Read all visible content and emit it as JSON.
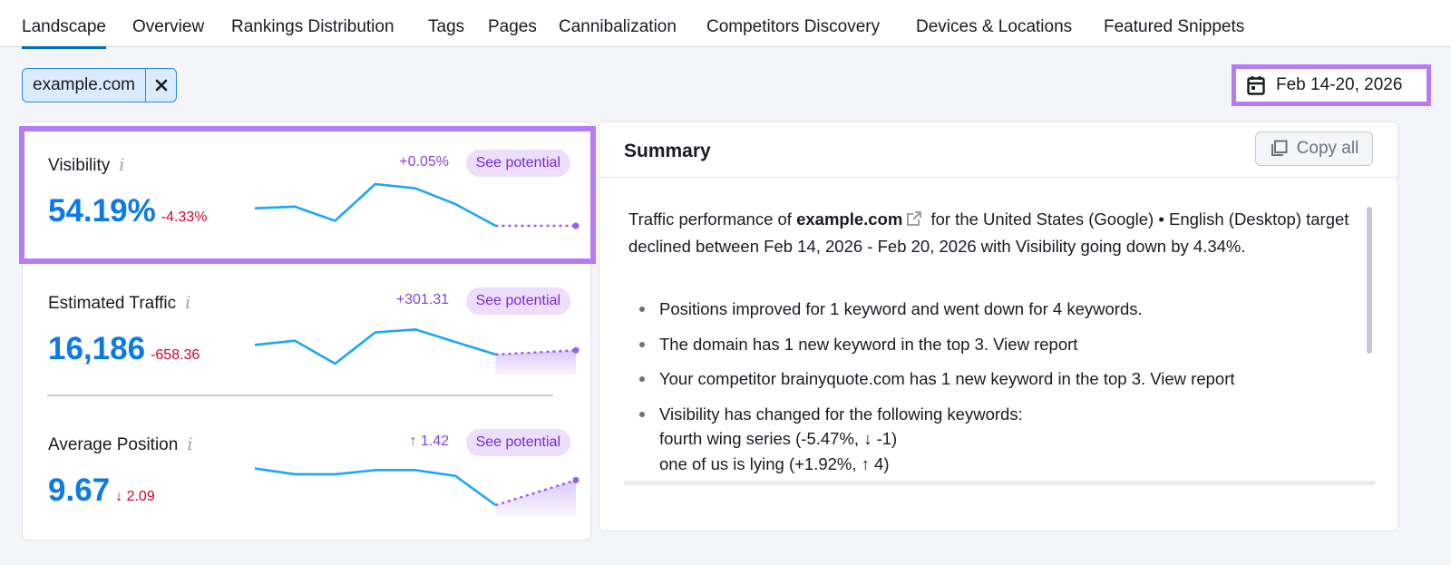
{
  "tabs": [
    "Landscape",
    "Overview",
    "Rankings Distribution",
    "Tags",
    "Pages",
    "Cannibalization",
    "Competitors Discovery",
    "Devices & Locations",
    "Featured Snippets"
  ],
  "filter_chip": {
    "label": "example.com"
  },
  "date_range": {
    "label": "Feb 14-20, 2026"
  },
  "metrics": {
    "visibility": {
      "label": "Visibility",
      "info": "i",
      "value": "54.19%",
      "change": "-4.33%",
      "delta": "+0.05%",
      "see": "See potential",
      "spark": [
        0.42,
        0.46,
        0.12,
        1.0,
        0.9,
        0.52,
        0.0,
        0.0,
        0.0
      ]
    },
    "traffic": {
      "label": "Estimated Traffic",
      "info": "i",
      "value": "16,186",
      "change": "-658.36",
      "delta": "+301.31",
      "see": "See potential",
      "spark": [
        0.45,
        0.55,
        0.0,
        0.75,
        0.82,
        0.52,
        0.22,
        0.25,
        0.32
      ]
    },
    "position": {
      "label": "Average Position",
      "info": "i",
      "value": "9.67",
      "change": "↓ 2.09",
      "delta": "↑ 1.42",
      "see": "See potential",
      "spark": [
        0.88,
        0.74,
        0.74,
        0.84,
        0.84,
        0.7,
        0.0,
        0.28,
        0.6
      ]
    }
  },
  "summary": {
    "title": "Summary",
    "copy_label": "Copy all",
    "intro_pre": "Traffic performance of ",
    "intro_domain": "example.com",
    "intro_post": " for the United States (Google) • English (Desktop) target declined between Feb 14, 2026 - Feb 20, 2026 with Visibility going down by 4.34%.",
    "bullet1": "Positions improved for 1 keyword and went down for 4 keywords.",
    "bullet2_text": "The domain has 1 new keyword in the top 3. ",
    "bullet2_link": "View report",
    "bullet3_text": "Your competitor brainyquote.com has 1 new keyword in the top 3. ",
    "bullet3_link": "View report",
    "bullet4_text": "Visibility has changed for the following keywords:",
    "kw1": {
      "name": "fourth wing series",
      "pct": "-5.47%",
      "pos": "↓ -1"
    },
    "kw2": {
      "name": "one of us is lying",
      "pct": "+1.92%",
      "pos": "↑ 4"
    }
  },
  "colors": {
    "accent": "#006dca",
    "highlight": "#b57cf5",
    "line": "#1ba7f5",
    "forecast": "#9a5cf0",
    "negative": "#d1002f",
    "positive": "#008a58"
  }
}
